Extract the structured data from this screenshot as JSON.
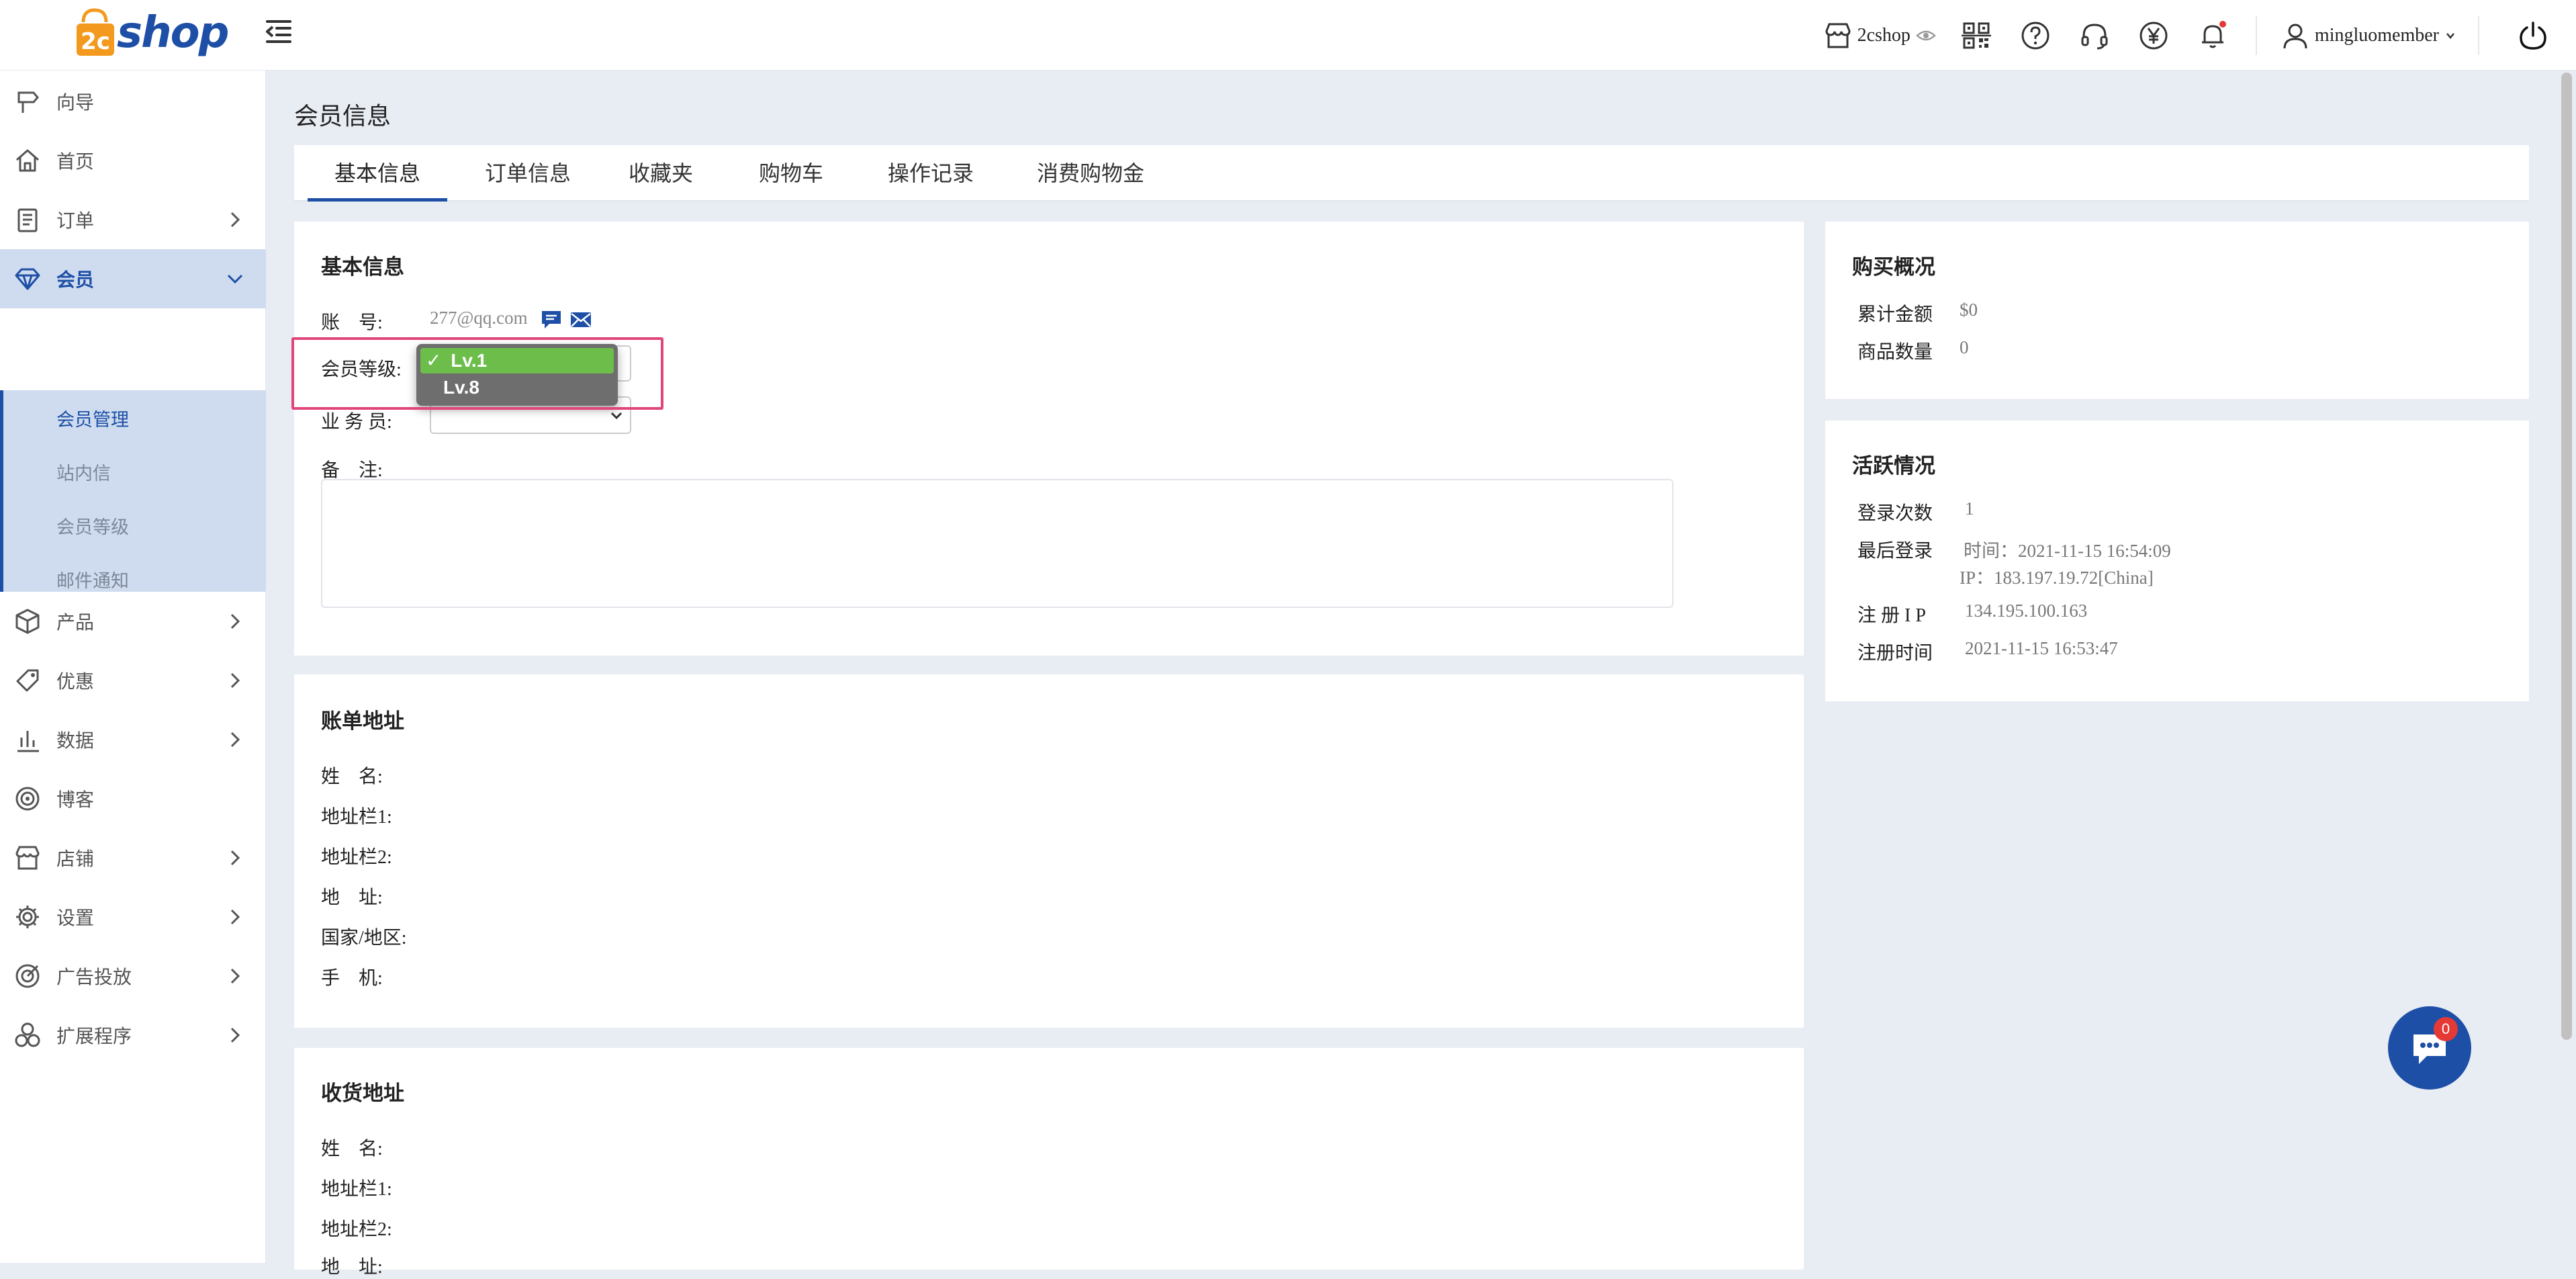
{
  "header": {
    "logo_text": "shop",
    "logo_mark": "2c",
    "store_name": "2cshop",
    "username": "mingluomember",
    "icons": [
      "store-icon",
      "eye-icon",
      "qr-code-icon",
      "help-icon",
      "headset-icon",
      "yen-icon",
      "bell-icon",
      "user-icon",
      "power-icon"
    ]
  },
  "sidebar": {
    "items": [
      {
        "label": "向导",
        "icon": "signpost-icon"
      },
      {
        "label": "首页",
        "icon": "home-icon"
      },
      {
        "label": "订单",
        "icon": "order-icon"
      },
      {
        "label": "会员",
        "icon": "member-icon"
      },
      {
        "label": "产品",
        "icon": "box-icon"
      },
      {
        "label": "优惠",
        "icon": "tag-icon"
      },
      {
        "label": "数据",
        "icon": "chart-icon"
      },
      {
        "label": "博客",
        "icon": "blog-icon"
      },
      {
        "label": "店铺",
        "icon": "shop-icon"
      },
      {
        "label": "设置",
        "icon": "gear-icon"
      },
      {
        "label": "广告投放",
        "icon": "target-icon"
      },
      {
        "label": "扩展程序",
        "icon": "extension-icon"
      }
    ],
    "sub_items": [
      "会员管理",
      "站内信",
      "会员等级",
      "邮件通知"
    ]
  },
  "main": {
    "page_title": "会员信息",
    "tabs": [
      "基本信息",
      "订单信息",
      "收藏夹",
      "购物车",
      "操作记录",
      "消费购物金"
    ],
    "basic": {
      "title": "基本信息",
      "account_label": "账　号:",
      "account_value": "277@qq.com",
      "level_label": "会员等级:",
      "sales_label": "业 务 员:",
      "remark_label": "备　注:",
      "level_options": [
        "Lv.1",
        "Lv.8"
      ],
      "check_mark": "✓"
    },
    "billing": {
      "title": "账单地址",
      "fields": [
        "姓　名:",
        "地址栏1:",
        "地址栏2:",
        "地　址:",
        "国家/地区:",
        "手　机:"
      ]
    },
    "shipping": {
      "title": "收货地址",
      "fields": [
        "姓　名:",
        "地址栏1:",
        "地址栏2:",
        "地　址:"
      ]
    },
    "purchase": {
      "title": "购买概况",
      "total_label": "累计金额",
      "total_value": "$0",
      "qty_label": "商品数量",
      "qty_value": "0"
    },
    "activity": {
      "title": "活跃情况",
      "login_count_label": "登录次数",
      "login_count_value": "1",
      "last_login_label": "最后登录",
      "last_login_time": "时间：2021-11-15 16:54:09",
      "last_login_ip": "IP：183.197.19.72[China]",
      "reg_ip_label": "注 册 I P",
      "reg_ip_value": "134.195.100.163",
      "reg_time_label": "注册时间",
      "reg_time_value": "2021-11-15 16:53:47"
    }
  },
  "chat": {
    "badge": "0"
  },
  "colors": {
    "brand": "#1e4fa6",
    "accent_orange": "#f39a1e",
    "highlight": "#e0457b",
    "selected_option": "#6cbd4a",
    "badge": "#e53935"
  }
}
